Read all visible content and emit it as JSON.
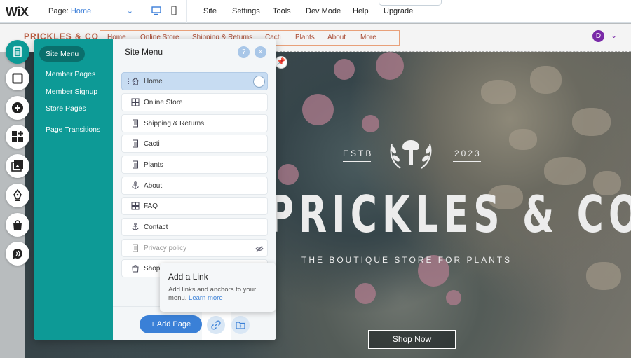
{
  "topbar": {
    "logo": "WiX",
    "page_label": "Page:",
    "page_value": "Home",
    "menus": [
      "Site",
      "Settings",
      "Tools",
      "Dev Mode",
      "Help",
      "Upgrade"
    ]
  },
  "site_header": {
    "brand": "PRICKLES & CO",
    "nav": [
      "Home",
      "Online Store",
      "Shipping & Returns",
      "Cacti",
      "Plants",
      "About",
      "More"
    ],
    "avatar_letter": "D"
  },
  "hero": {
    "estb_left": "ESTB",
    "estb_right": "2023",
    "title": "PRICKLES & CO",
    "subtitle": "THE BOUTIQUE STORE FOR PLANTS",
    "shop_button": "Shop Now"
  },
  "toolbar": {
    "tools": [
      {
        "name": "pages-icon",
        "active": true
      },
      {
        "name": "background-icon",
        "active": false
      },
      {
        "name": "add-icon",
        "active": false
      },
      {
        "name": "apps-icon",
        "active": false
      },
      {
        "name": "media-icon",
        "active": false
      },
      {
        "name": "blog-icon",
        "active": false
      },
      {
        "name": "store-icon",
        "active": false
      },
      {
        "name": "chat-icon",
        "active": false
      }
    ]
  },
  "panel": {
    "side_items": [
      "Site Menu",
      "Member Pages",
      "Member Signup",
      "Store Pages",
      "Page Transitions"
    ],
    "title": "Site Menu",
    "help": "?",
    "close": "×",
    "pages": [
      {
        "label": "Home",
        "icon": "home-icon"
      },
      {
        "label": "Online Store",
        "icon": "store-page-icon"
      },
      {
        "label": "Shipping & Returns",
        "icon": "page-icon"
      },
      {
        "label": "Cacti",
        "icon": "page-icon"
      },
      {
        "label": "Plants",
        "icon": "page-icon"
      },
      {
        "label": "About",
        "icon": "anchor-icon"
      },
      {
        "label": "FAQ",
        "icon": "store-page-icon"
      },
      {
        "label": "Contact",
        "icon": "anchor-icon"
      },
      {
        "label": "Privacy policy",
        "icon": "page-icon"
      },
      {
        "label": "Shop",
        "icon": "shop-icon"
      }
    ],
    "add_page": "+ Add Page"
  },
  "tooltip": {
    "title": "Add a Link",
    "body": "Add links and anchors to your menu.",
    "link": "Learn more"
  },
  "colors": {
    "accent": "#0d9a96",
    "primary_blue": "#3a80d7",
    "brand": "#b85a3e"
  }
}
